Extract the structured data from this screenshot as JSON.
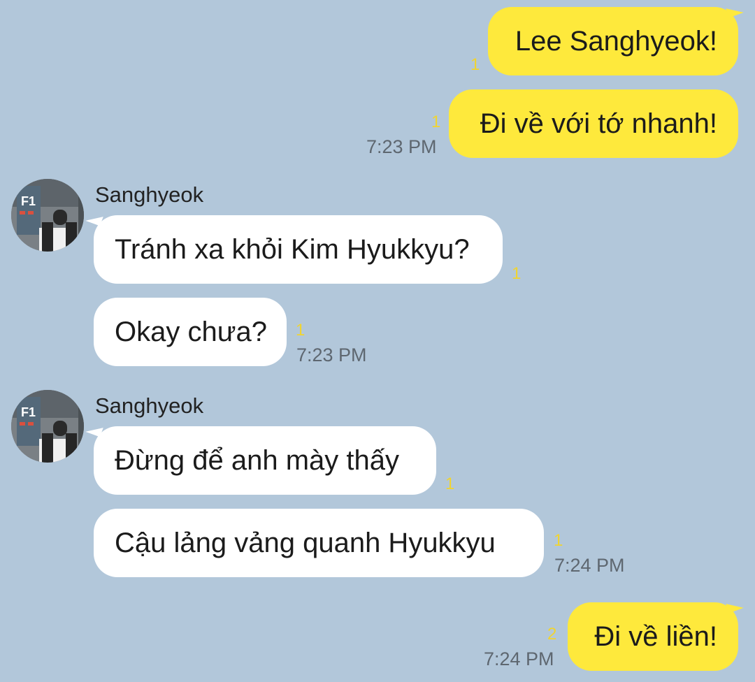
{
  "chat": {
    "messages": [
      {
        "text": "Lee Sanghyeok!",
        "unread": "1"
      },
      {
        "text": "Đi về với tớ nhanh!",
        "unread": "1",
        "time": "7:23 PM"
      },
      {
        "text": "Tránh xa khỏi Kim Hyukkyu?",
        "unread": "1"
      },
      {
        "text": "Okay chưa?",
        "unread": "1",
        "time": "7:23 PM"
      },
      {
        "text": "Đừng để anh mày thấy",
        "unread": "1"
      },
      {
        "text": "Cậu lảng vảng quanh Hyukkyu",
        "unread": "1",
        "time": "7:24 PM"
      },
      {
        "text": "Đi về liền!",
        "unread": "2",
        "time": "7:24 PM"
      }
    ],
    "groups": [
      {
        "sender": "Sanghyeok",
        "avatar_sign": "F1"
      },
      {
        "sender": "Sanghyeok",
        "avatar_sign": "F1"
      }
    ]
  },
  "colors": {
    "background": "#b2c7da",
    "my_bubble": "#fee93c",
    "their_bubble": "#ffffff",
    "unread": "#f0d431"
  }
}
